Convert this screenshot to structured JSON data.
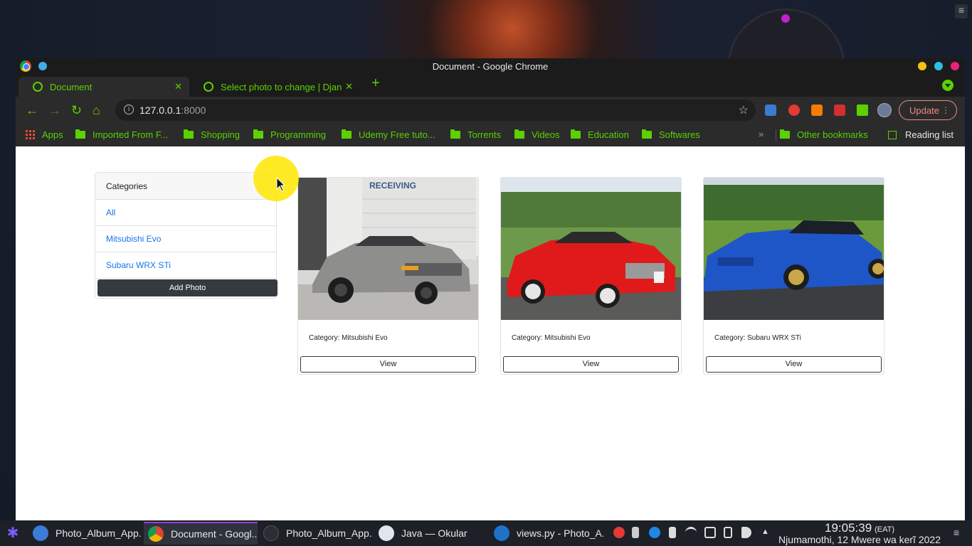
{
  "window": {
    "title": "Document - Google Chrome",
    "tabs": [
      {
        "label": "Document",
        "close": "✕"
      },
      {
        "label": "Select photo to change | Djan",
        "close": "✕"
      }
    ],
    "new_tab": "+"
  },
  "toolbar": {
    "url_host": "127.0.0.1",
    "url_port": ":8000",
    "update_label": "Update"
  },
  "bookmarks": {
    "items": [
      "Apps",
      "Imported From F...",
      "Shopping",
      "Programming",
      "Udemy Free tuto...",
      "Torrents",
      "Videos",
      "Education",
      "Softwares"
    ],
    "more": "»",
    "other": "Other bookmarks",
    "reading_list": "Reading list"
  },
  "page": {
    "sidebar": {
      "heading": "Categories",
      "items": [
        "All",
        "Mitsubishi Evo",
        "Subaru WRX STi"
      ],
      "add_button": "Add Photo"
    },
    "cards": [
      {
        "category": "Category: Mitsubishi Evo",
        "button": "View",
        "car_color": "#8e8f8c"
      },
      {
        "category": "Category: Mitsubishi Evo",
        "button": "View",
        "car_color": "#e01a1a"
      },
      {
        "category": "Category: Subaru WRX STi",
        "button": "View",
        "car_color": "#1e56c8"
      }
    ],
    "sign_text": "RECEIVING"
  },
  "taskbar": {
    "tasks": [
      "Photo_Album_App...",
      "Document - Googl...",
      "Photo_Album_App...",
      "Java  — Okular",
      "views.py - Photo_A..."
    ],
    "time": "19:05:39",
    "timezone": "(EAT)",
    "date": "Njumamothi, 12 Mwere wa kerĩ 2022"
  },
  "colors": {
    "accent_green": "#5bd100",
    "link_blue": "#1a73e8",
    "dark_button": "#343a40"
  }
}
